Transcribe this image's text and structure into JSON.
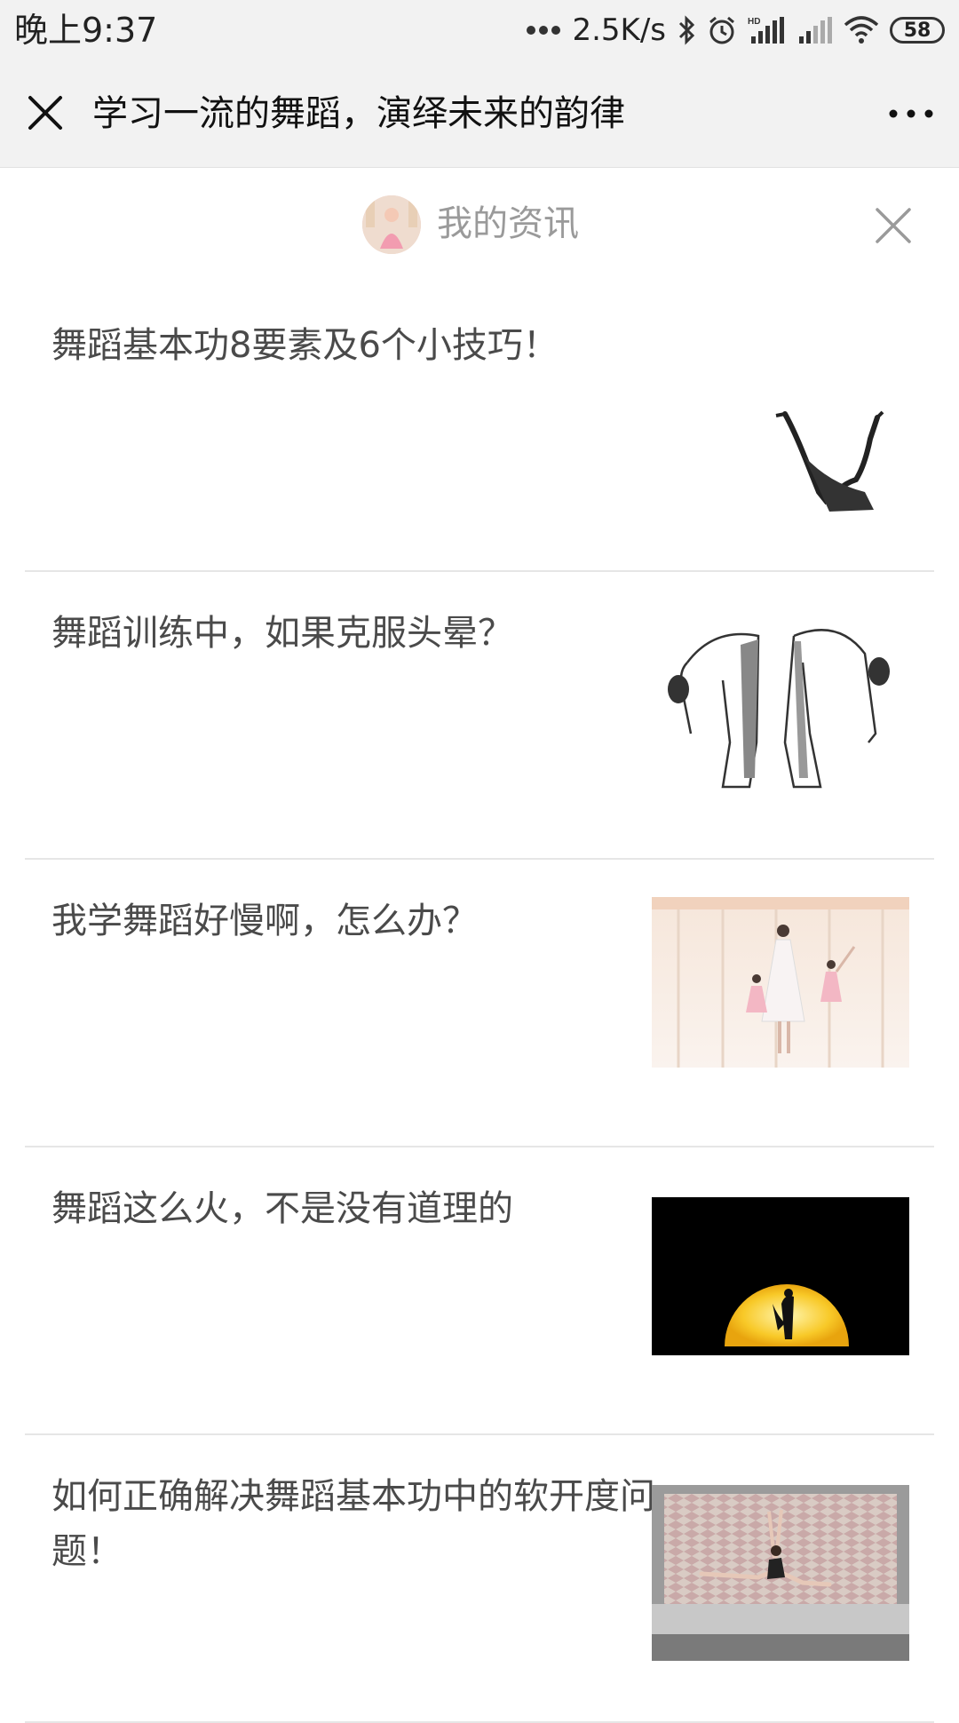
{
  "status_bar": {
    "time": "晚上9:37",
    "network_speed": "2.5K/s",
    "battery": "58",
    "icons": [
      "more-dots-icon",
      "bluetooth-icon",
      "alarm-icon",
      "hd-signal-icon",
      "signal-icon",
      "wifi-icon",
      "battery-icon"
    ]
  },
  "nav": {
    "title": "学习一流的舞蹈，演绎未来的韵律",
    "close_icon": "close-icon",
    "more_icon": "more-icon"
  },
  "panel": {
    "title": "我的资讯",
    "close_icon": "close-icon"
  },
  "news": [
    {
      "title": "舞蹈基本功8要素及6个小技巧！",
      "thumb": "dancer-silhouette-image"
    },
    {
      "title": "舞蹈训练中，如果克服头晕？",
      "thumb": "forward-bend-sketch-image"
    },
    {
      "title": "我学舞蹈好慢啊，怎么办？",
      "thumb": "ballet-class-image"
    },
    {
      "title": "舞蹈这么火，不是没有道理的",
      "thumb": "moon-dancer-image"
    },
    {
      "title": "如何正确解决舞蹈基本功中的软开度问题！",
      "thumb": "leaping-dancer-image"
    }
  ],
  "colors": {
    "bar_bg": "#f2f2f2",
    "title_text": "#4a4a4a",
    "panel_title": "#9a9a9a",
    "divider": "#e6e6e6"
  }
}
